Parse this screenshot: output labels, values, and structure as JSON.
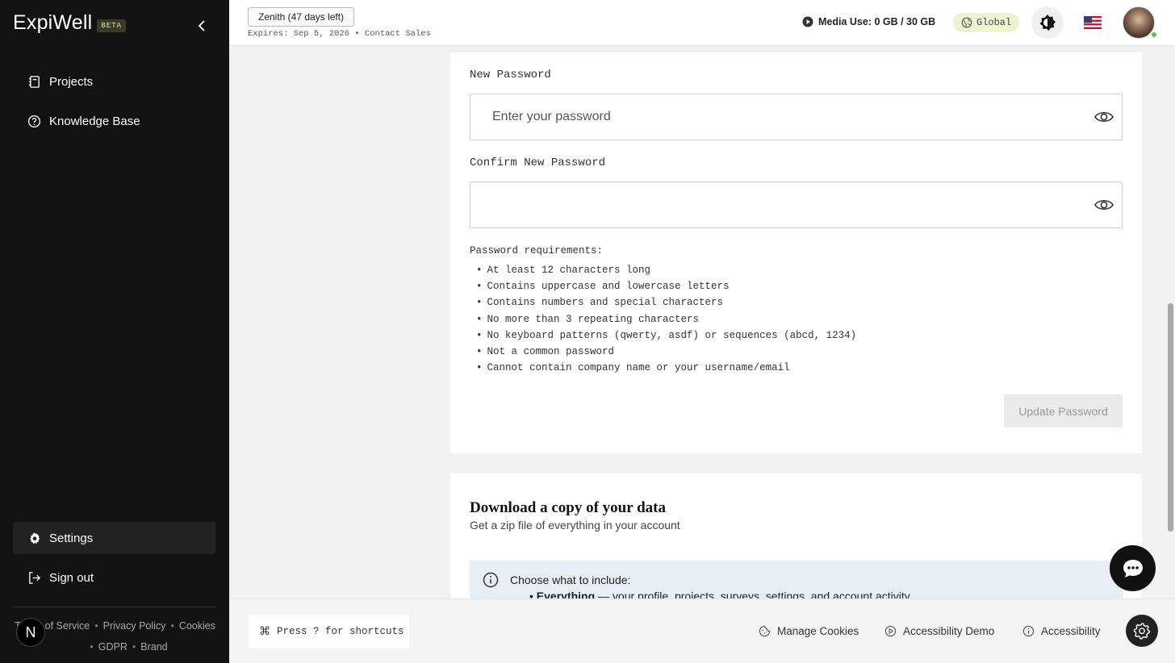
{
  "sidebar": {
    "logo": "ExpiWell",
    "badge": "BETA",
    "items": [
      {
        "label": "Projects"
      },
      {
        "label": "Knowledge Base"
      },
      {
        "label": "Settings"
      },
      {
        "label": "Sign out"
      }
    ],
    "footer": {
      "terms": "Terms of Service",
      "privacy": "Privacy Policy",
      "cookies": "Cookies",
      "gdpr": "GDPR",
      "brand": "Brand"
    },
    "avatar_initial": "N"
  },
  "topbar": {
    "plan": "Zenith (47 days left)",
    "expires": "Expires: Sep 5, 2026 • Contact Sales",
    "media_use": "Media Use: 0 GB / 30 GB",
    "region": "Global"
  },
  "password": {
    "new_label": "New Password",
    "new_placeholder": "Enter your password",
    "confirm_label": "Confirm New Password",
    "confirm_value": "",
    "requirements_title": "Password requirements:",
    "requirements": [
      "At least 12 characters long",
      "Contains uppercase and lowercase letters",
      "Contains numbers and special characters",
      "No more than 3 repeating characters",
      "No keyboard patterns (qwerty, asdf) or sequences (abcd, 1234)",
      "Not a common password",
      "Cannot contain company name or your username/email"
    ],
    "update_button": "Update Password"
  },
  "download": {
    "title": "Download a copy of your data",
    "subtitle": "Get a zip file of everything in your account",
    "choose_label": "Choose what to include:",
    "option_bold": "Everything",
    "option_rest": " — your profile, projects, surveys, settings, and account activity"
  },
  "bottombar": {
    "shortcut": "Press ? for shortcuts",
    "manage_cookies": "Manage Cookies",
    "accessibility_demo": "Accessibility Demo",
    "accessibility": "Accessibility"
  },
  "colors": {
    "sidebar_bg": "#121212",
    "region_badge": "#eef3d0",
    "info_bg": "#e8eef6",
    "online": "#5fbf5f"
  }
}
